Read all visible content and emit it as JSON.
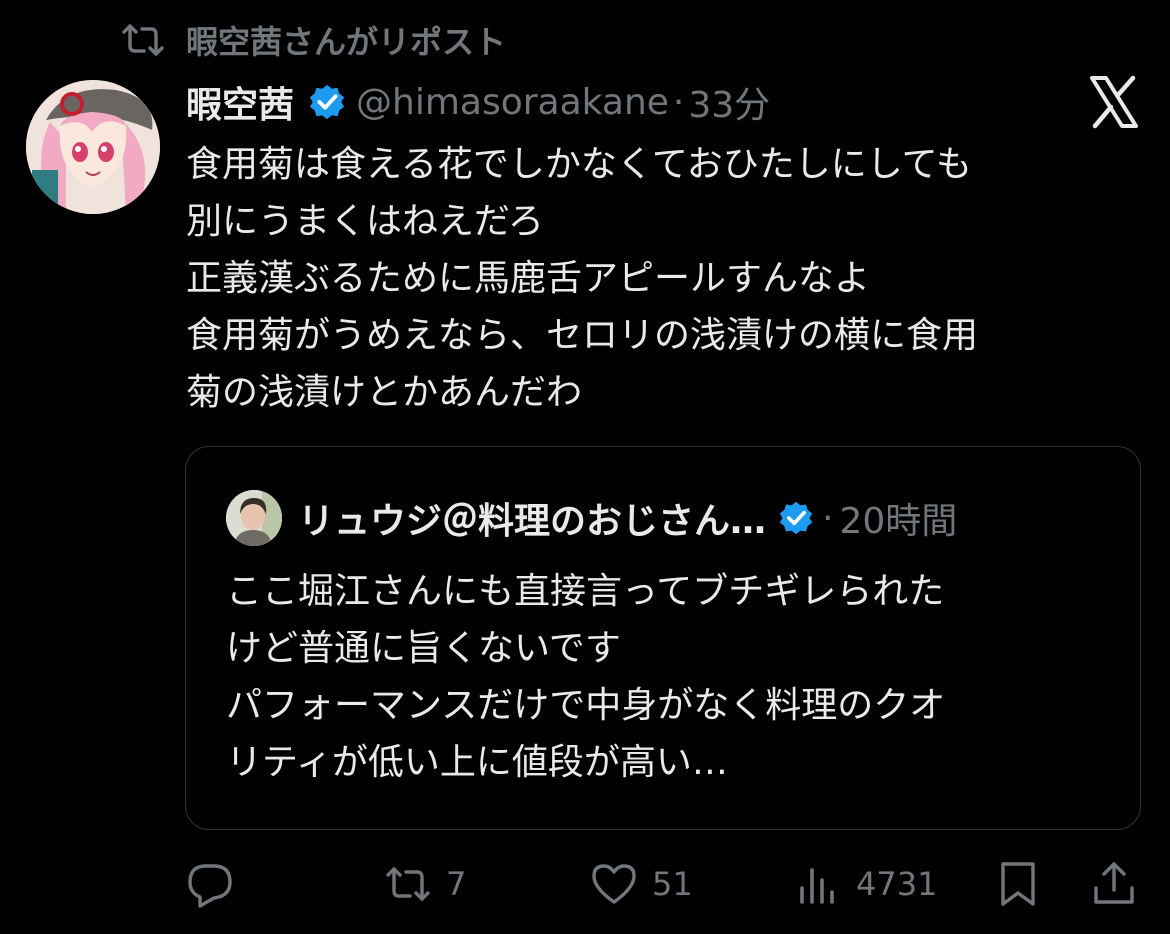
{
  "repost": {
    "text": "暇空茜さんがリポスト"
  },
  "author": {
    "name": "暇空茜",
    "handle": "@himasoraakane",
    "separator": "·",
    "time": "33分"
  },
  "tweet": {
    "lines": [
      "食用菊は食える花でしかなくておひたしにしても",
      "別にうまくはねえだろ",
      "正義漢ぶるために馬鹿舌アピールすんなよ",
      "食用菊がうめえなら、セロリの浅漬けの横に食用",
      "菊の浅漬けとかあんだわ"
    ]
  },
  "quote": {
    "name": "リュウジ＠料理のおじさん…",
    "separator": "·",
    "time": "20時間",
    "lines": [
      "ここ堀江さんにも直接言ってブチギレられた",
      "けど普通に旨くないです",
      "パフォーマンスだけで中身がなく料理のクオ",
      "リティが低い上に値段が高い…"
    ]
  },
  "actions": {
    "reply": {
      "icon": "reply-icon",
      "count": ""
    },
    "repost": {
      "icon": "repost-icon",
      "count": "7"
    },
    "like": {
      "icon": "heart-icon",
      "count": "51"
    },
    "views": {
      "icon": "views-icon",
      "count": "4731"
    },
    "bookmark": {
      "icon": "bookmark-icon"
    },
    "share": {
      "icon": "share-icon"
    }
  },
  "colors": {
    "background": "#000000",
    "text": "#e7e9ea",
    "muted": "#71767b",
    "verified": "#1d9bf0",
    "border": "#2f3336"
  }
}
